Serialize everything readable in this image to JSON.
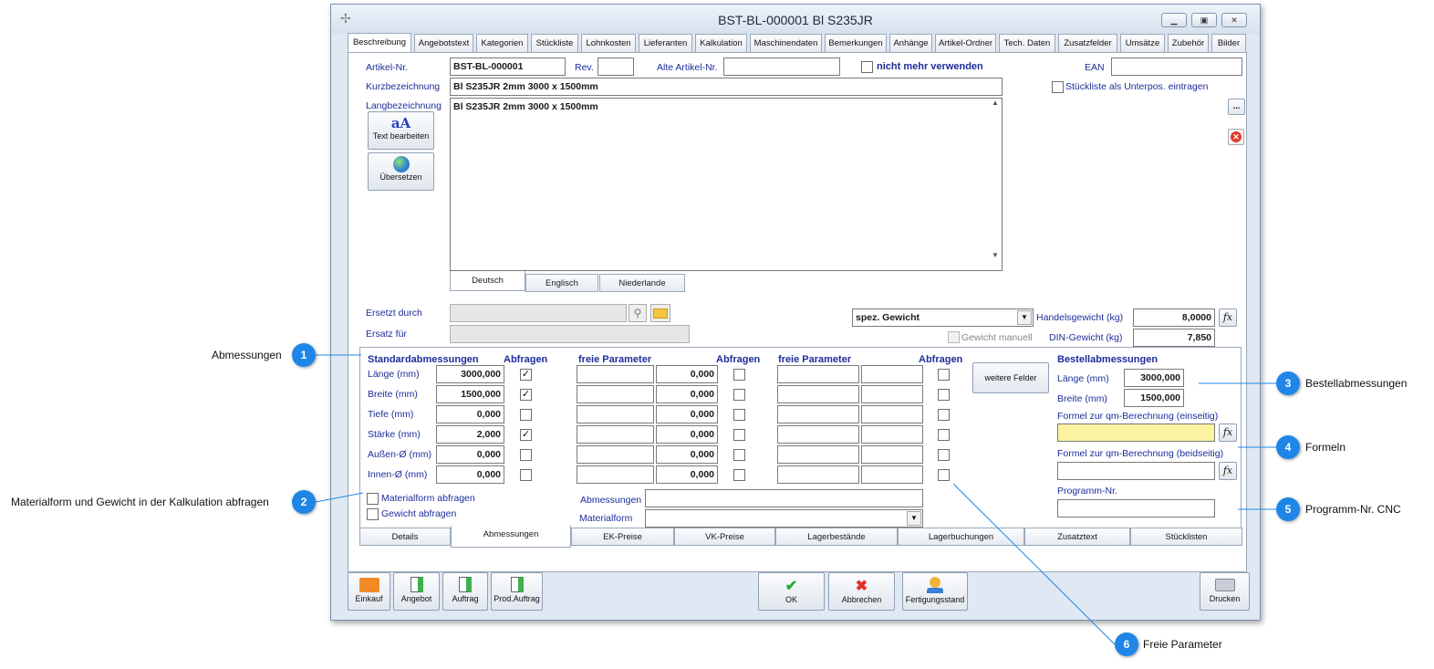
{
  "window": {
    "title": "BST-BL-000001 Bl S235JR"
  },
  "tabs": [
    "Beschreibung",
    "Angebotstext",
    "Kategorien",
    "Stückliste",
    "Lohnkosten",
    "Lieferanten",
    "Kalkulation",
    "Maschinendaten",
    "Bemerkungen",
    "Anhänge",
    "Artikel-Ordner",
    "Tech. Daten",
    "Zusatzfelder",
    "Umsätze",
    "Zubehör",
    "Bilder"
  ],
  "form": {
    "artikel_label": "Artikel-Nr.",
    "artikel_value": "BST-BL-000001",
    "rev_label": "Rev.",
    "rev_value": "",
    "alte_label": "Alte Artikel-Nr.",
    "alte_value": "",
    "nicht_mehr": "nicht mehr verwenden",
    "ean_label": "EAN",
    "ean_value": "",
    "kurz_label": "Kurzbezeichnung",
    "kurz_value": "Bl S235JR 2mm 3000 x 1500mm",
    "stueckliste_unterpos": "Stückliste als Unterpos. eintragen",
    "lang_label": "Langbezeichnung",
    "lang_value": "Bl S235JR 2mm 3000 x 1500mm",
    "text_bearbeiten": "Text bearbeiten",
    "uebersetzen": "Übersetzen",
    "dots_button": "...",
    "lang_tabs": [
      "Deutsch",
      "Englisch",
      "Niederlande"
    ],
    "ersetzt_label": "Ersetzt durch",
    "ersatz_label": "Ersatz für",
    "gewicht_select": "spez. Gewicht",
    "gewicht_manuell": "Gewicht manuell",
    "handels_label": "Handelsgewicht (kg)",
    "handels_value": "8,0000",
    "din_label": "DIN-Gewicht (kg)",
    "din_value": "7,850"
  },
  "dims": {
    "std_header": "Standardabmessungen",
    "abfragen": "Abfragen",
    "freie_header": "freie Parameter",
    "rows": [
      {
        "label": "Länge (mm)",
        "value": "3000,000",
        "checked": true
      },
      {
        "label": "Breite (mm)",
        "value": "1500,000",
        "checked": true
      },
      {
        "label": "Tiefe (mm)",
        "value": "0,000",
        "checked": false
      },
      {
        "label": "Stärke (mm)",
        "value": "2,000",
        "checked": true
      },
      {
        "label": "Außen-Ø (mm)",
        "value": "0,000",
        "checked": false
      },
      {
        "label": "Innen-Ø (mm)",
        "value": "0,000",
        "checked": false
      }
    ],
    "freie_values": [
      "0,000",
      "0,000",
      "0,000",
      "0,000",
      "0,000",
      "0,000"
    ],
    "materialform_abfragen": "Materialform abfragen",
    "gewicht_abfragen": "Gewicht abfragen",
    "abmessungen_label": "Abmessungen",
    "materialform_label": "Materialform",
    "weitere_felder": "weitere Felder",
    "bestell_header": "Bestellabmessungen",
    "bestell_laenge_label": "Länge (mm)",
    "bestell_laenge": "3000,000",
    "bestell_breite_label": "Breite (mm)",
    "bestell_breite": "1500,000",
    "formel_einseitig": "Formel zur qm-Berechnung (einseitig)",
    "formel_beidseitig": "Formel zur qm-Berechnung (beidseitig)",
    "programm_label": "Programm-Nr.",
    "fx": "fx"
  },
  "bottom_tabs": [
    "Details",
    "Abmessungen",
    "EK-Preise",
    "VK-Preise",
    "Lagerbestände",
    "Lagerbuchungen",
    "Zusatztext",
    "Stücklisten"
  ],
  "footer": {
    "einkauf": "Einkauf",
    "angebot": "Angebot",
    "auftrag": "Auftrag",
    "prod_auftrag": "Prod.Auftrag",
    "ok": "OK",
    "abbrechen": "Abbrechen",
    "fertigungsstand": "Fertigungsstand",
    "drucken": "Drucken"
  },
  "callouts": [
    {
      "num": "1",
      "text": "Abmessungen"
    },
    {
      "num": "2",
      "text": "Materialform und Gewicht in der Kalkulation abfragen"
    },
    {
      "num": "3",
      "text": "Bestellabmessungen"
    },
    {
      "num": "4",
      "text": "Formeln"
    },
    {
      "num": "5",
      "text": "Programm-Nr. CNC"
    },
    {
      "num": "6",
      "text": "Freie Parameter"
    }
  ],
  "colors": {
    "accent": "#1f86e8",
    "label": "#1d2d9a",
    "yellow": "#fbf3a0"
  }
}
